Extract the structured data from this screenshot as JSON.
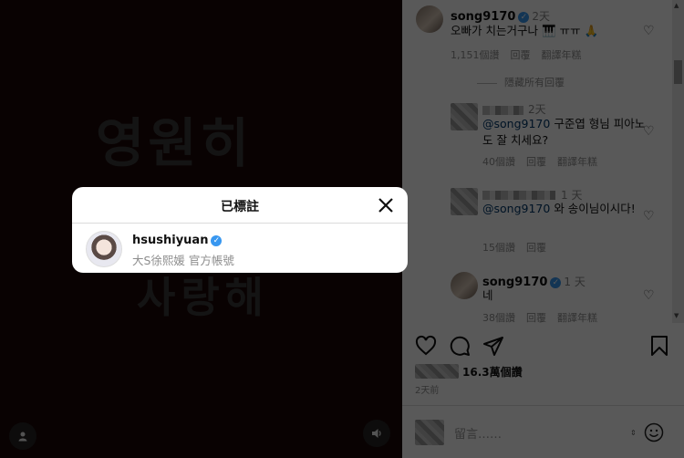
{
  "media": {
    "overlay_text_top": "영원히",
    "overlay_text_bottom": "사랑해",
    "user_icon": "user-icon",
    "sound_icon": "sound-icon"
  },
  "comments": {
    "main": {
      "username": "song9170",
      "time": "2天",
      "text": "오빠가 치는거구나 🎹 ㅠㅠ 🙏",
      "likes": "1,151個讚",
      "reply": "回覆",
      "translate": "翻譯年糕"
    },
    "hide_replies": "隱藏所有回覆",
    "replies": [
      {
        "time": "2天",
        "mention": "@song9170",
        "text": " 구준엽 형님 피아노도 잘 치세요?",
        "likes": "40個讚",
        "reply": "回覆",
        "translate": "翻譯年糕"
      },
      {
        "time": "1 天",
        "mention": "@song9170",
        "text": " 와 송이님이시다!",
        "likes": "15個讚",
        "reply": "回覆",
        "translate": ""
      },
      {
        "username": "song9170",
        "time": "1 天",
        "text": "네",
        "likes": "38個讚",
        "reply": "回覆",
        "translate": "翻譯年糕"
      }
    ]
  },
  "post": {
    "likes": "16.3萬個讚",
    "posted": "2天前",
    "comment_placeholder": "留言……"
  },
  "modal": {
    "title": "已標註",
    "tagged_username": "hsushiyuan",
    "tagged_fullname": "大S徐熙媛 官方帳號"
  },
  "colors": {
    "verified": "#3897f0",
    "media_bg": "#1a0707"
  }
}
